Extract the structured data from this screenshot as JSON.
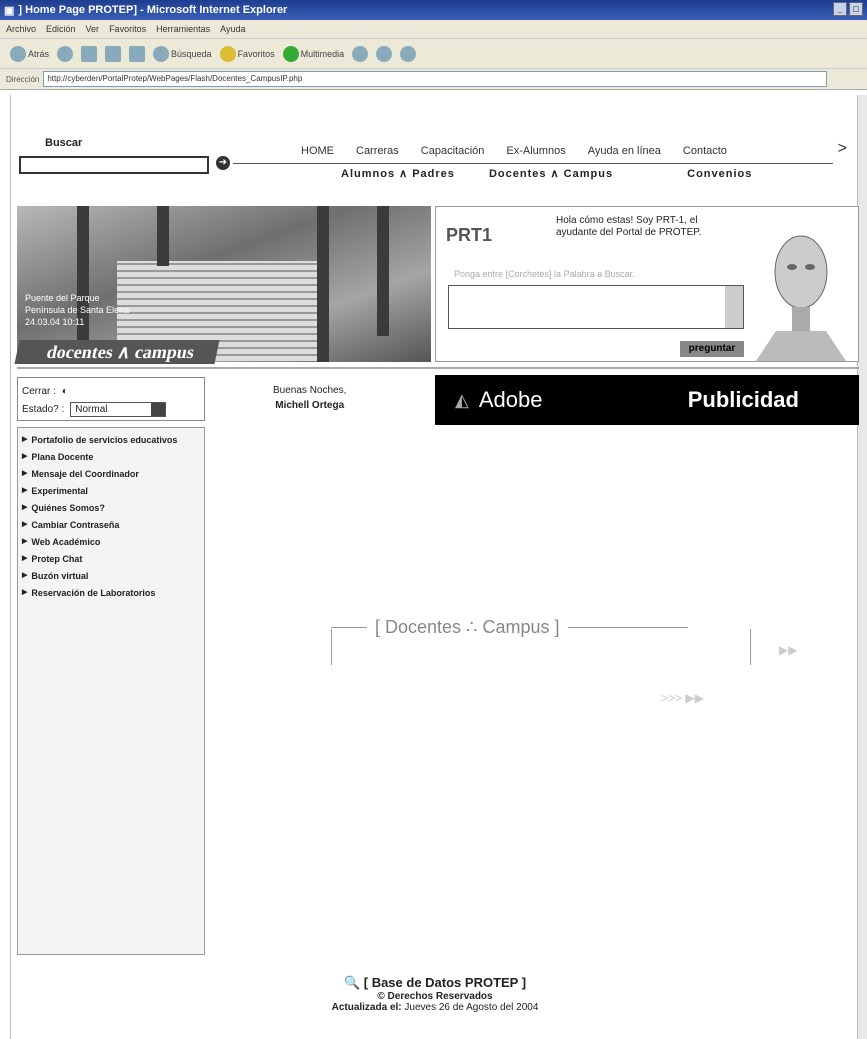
{
  "window": {
    "title": "] Home Page PROTEP] - Microsoft Internet Explorer"
  },
  "menu": [
    "Archivo",
    "Edición",
    "Ver",
    "Favoritos",
    "Herramientas",
    "Ayuda"
  ],
  "toolbar": {
    "back": "Atrás",
    "search": "Búsqueda",
    "favorites": "Favoritos",
    "multimedia": "Multimedia"
  },
  "address": {
    "label": "Dirección",
    "url": "http://cyberden/PortalProtep/WebPages/Flash/Docentes_CampusIP.php"
  },
  "search": {
    "label": "Buscar"
  },
  "nav_top": [
    "HOME",
    "Carreras",
    "Capacitación",
    "Ex-Alumnos",
    "Ayuda en línea",
    "Contacto"
  ],
  "nav_bottom": [
    "Alumnos ∧ Padres",
    "Docentes ∧ Campus",
    "Convenios"
  ],
  "hero": {
    "caption_1": "Puente del Parque",
    "caption_2": "Península de Santa Elena",
    "caption_3": "24.03.04 10:11",
    "banner": "docentes ∧ campus"
  },
  "assistant": {
    "logo": "PRT1",
    "text": "Hola cómo estas! Soy PRT-1, el ayudante del Portal de PROTEP.",
    "hint": "Ponga entre [Corchetes] la Palabra a Buscar.",
    "ask": "preguntar"
  },
  "status": {
    "close_label": "Cerrar :",
    "state_label": "Estado? :",
    "state_value": "Normal"
  },
  "greeting": {
    "text": "Buenas Noches,",
    "name": "Michell Ortega"
  },
  "ad": {
    "brand": "Adobe",
    "label": "Publicidad"
  },
  "sidebar": [
    "Portafolio de servicios educativos",
    "Plana Docente",
    "Mensaje del Coordinador",
    "Experimental",
    "Quiénes Somos?",
    "Cambiar Contraseña",
    "Web Académico",
    "Protep Chat",
    "Buzón virtual",
    "Reservación de Laboratorios"
  ],
  "center": {
    "title": "[ Docentes ∴ Campus ]"
  },
  "footer": {
    "title": "[ Base de Datos PROTEP ]",
    "rights": "© Derechos Reservados",
    "updated_label": "Actualizada el:",
    "updated_date": "Jueves 26 de Agosto del 2004"
  }
}
